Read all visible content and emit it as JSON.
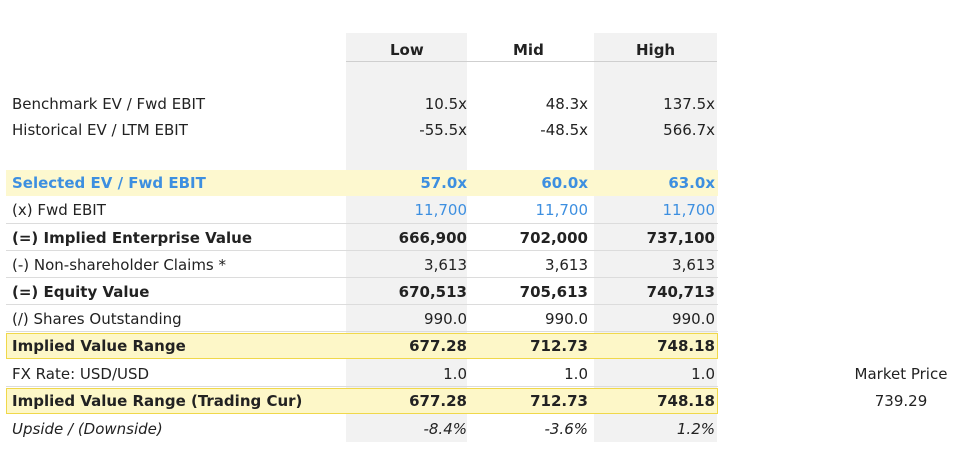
{
  "columns": {
    "low": "Low",
    "mid": "Mid",
    "high": "High"
  },
  "rows": {
    "benchmark": {
      "label": "Benchmark EV / Fwd EBIT",
      "low": "10.5x",
      "mid": "48.3x",
      "high": "137.5x"
    },
    "historical": {
      "label": "Historical EV / LTM EBIT",
      "low": "-55.5x",
      "mid": "-48.5x",
      "high": "566.7x"
    },
    "selected": {
      "label": "Selected EV / Fwd EBIT",
      "low": "57.0x",
      "mid": "60.0x",
      "high": "63.0x"
    },
    "fwd_ebit": {
      "label": "(x) Fwd EBIT",
      "low": "11,700",
      "mid": "11,700",
      "high": "11,700"
    },
    "implied_ev": {
      "label": "(=) Implied Enterprise Value",
      "low": "666,900",
      "mid": "702,000",
      "high": "737,100"
    },
    "non_shareholder": {
      "label": "(-) Non-shareholder Claims *",
      "low": "3,613",
      "mid": "3,613",
      "high": "3,613"
    },
    "equity_value": {
      "label": "(=) Equity Value",
      "low": "670,513",
      "mid": "705,613",
      "high": "740,713"
    },
    "shares": {
      "label": "(/) Shares Outstanding",
      "low": "990.0",
      "mid": "990.0",
      "high": "990.0"
    },
    "implied_range": {
      "label": "Implied Value Range",
      "low": "677.28",
      "mid": "712.73",
      "high": "748.18"
    },
    "fx_rate": {
      "label": "FX Rate: USD/USD",
      "low": "1.0",
      "mid": "1.0",
      "high": "1.0"
    },
    "implied_range_trading": {
      "label": "Implied Value Range (Trading Cur)",
      "low": "677.28",
      "mid": "712.73",
      "high": "748.18"
    },
    "upside": {
      "label": "Upside / (Downside)",
      "low": "-8.4%",
      "mid": "-3.6%",
      "high": "1.2%"
    }
  },
  "market_price": {
    "label": "Market Price",
    "value": "739.29"
  },
  "colors": {
    "accent_blue": "#3d8fe0",
    "highlight_fill": "#fdf7c8",
    "highlight_border": "#f0d84a",
    "column_shade": "#f2f2f2"
  }
}
